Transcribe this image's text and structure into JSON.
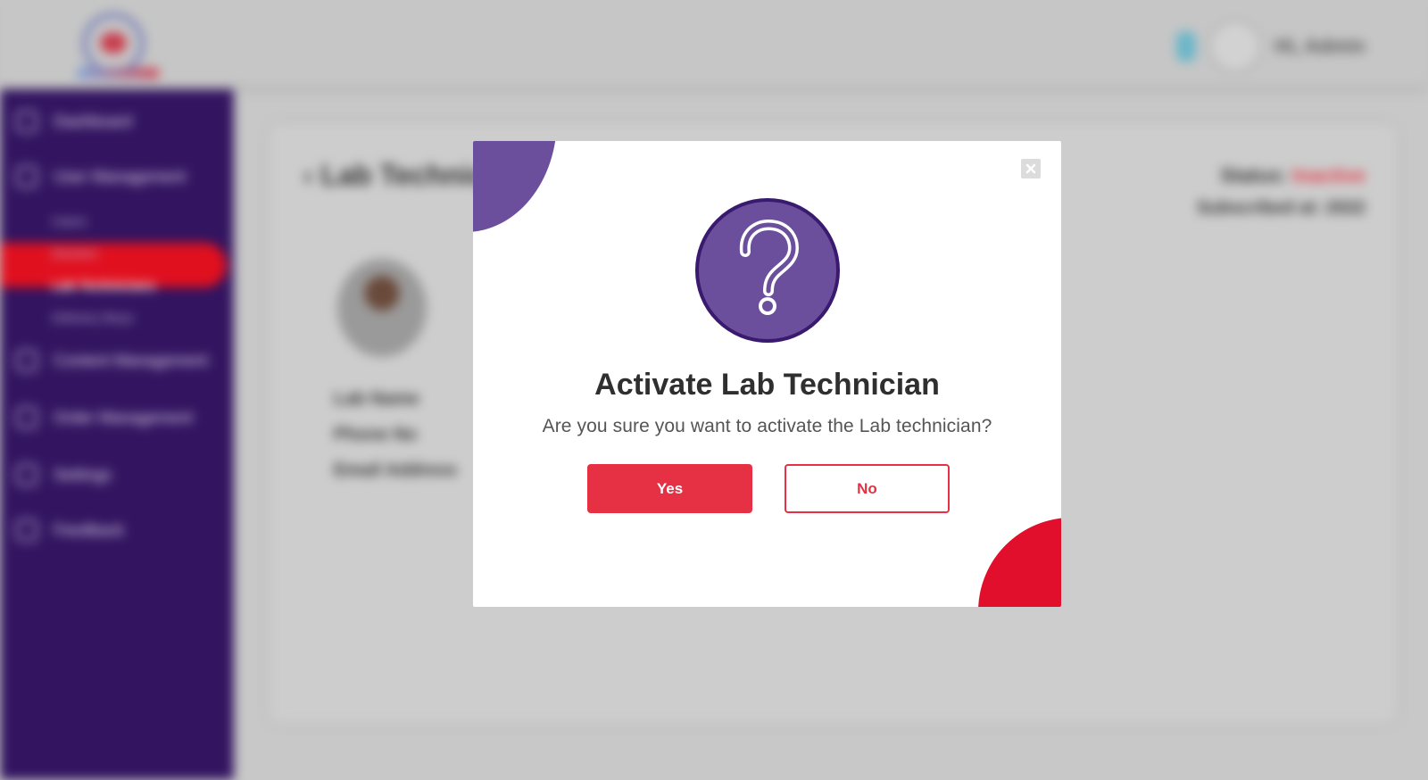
{
  "background": {
    "user_greeting": "Hi, Admin",
    "sidebar": {
      "items": [
        {
          "label": "Dashboard"
        },
        {
          "label": "User Management"
        },
        {
          "label": "Content Management"
        },
        {
          "label": "Order Management"
        },
        {
          "label": "Settings"
        },
        {
          "label": "Feedback"
        }
      ],
      "sub_items": [
        "Users",
        "Doctors",
        "Lab Technicians",
        "Delivery Boys"
      ]
    },
    "page_title": "Lab Technician",
    "status_label": "Status:",
    "status_value": "Inactive",
    "member_since": "Subscribed at: 2022",
    "info_lines": [
      "Lab Name",
      "Phone No",
      "Email Address"
    ]
  },
  "modal": {
    "title": "Activate Lab Technician",
    "message": "Are you sure you want to activate the Lab technician?",
    "yes_label": "Yes",
    "no_label": "No",
    "icon": "question-mark-icon",
    "close_icon": "close-icon"
  },
  "colors": {
    "purple": "#6b4f9d",
    "dark_purple": "#321460",
    "red": "#e63144",
    "accent_red": "#e20f2c"
  }
}
